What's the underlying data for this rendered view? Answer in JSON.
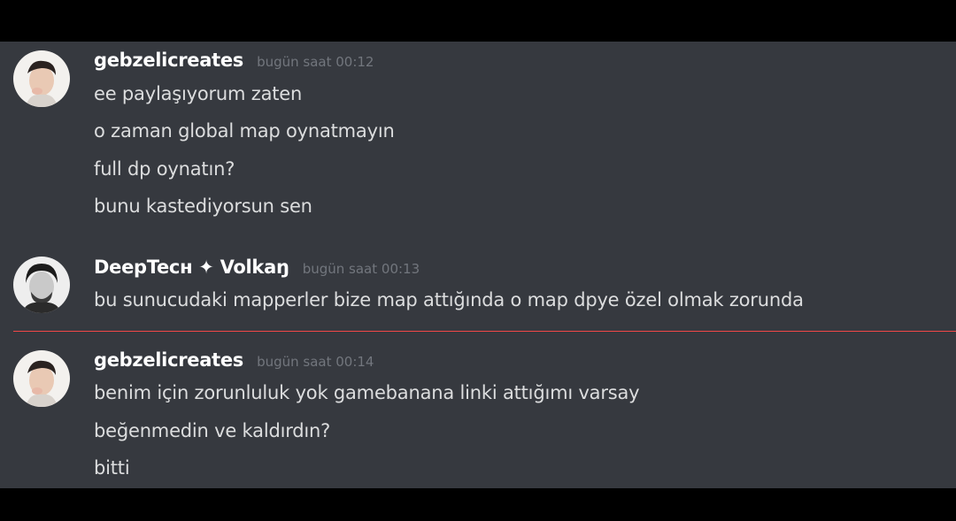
{
  "messages": [
    {
      "author": "gebzelicreates",
      "timestamp": "bugün saat 00:12",
      "lines": [
        "ee paylaşıyorum zaten",
        "o zaman global map oynatmayın",
        "full dp oynatın?",
        "bunu kastediyorsun sen"
      ]
    },
    {
      "author": "DeepTecн ✦ Volkaŋ",
      "timestamp": "bugün saat 00:13",
      "lines": [
        "bu sunucudaki mapperler bize map attığında o map dpye özel olmak zorunda"
      ]
    },
    {
      "author": "gebzelicreates",
      "timestamp": "bugün saat 00:14",
      "lines": [
        "benim için zorunluluk yok gamebanana linki attığımı varsay",
        "beğenmedin ve kaldırdın?",
        "bitti"
      ]
    }
  ],
  "colors": {
    "background": "#36393f",
    "letterbox": "#000000",
    "username": "#ffffff",
    "message_text": "#dcddde",
    "timestamp": "#72767d",
    "new_messages_divider": "#f04747"
  }
}
